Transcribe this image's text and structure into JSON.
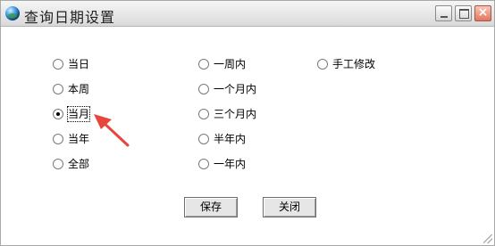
{
  "window": {
    "title": "查询日期设置"
  },
  "options": {
    "today": "当日",
    "this_week": "本周",
    "this_month": "当月",
    "this_year": "当年",
    "all": "全部",
    "one_week": "一周内",
    "one_month": "一个月内",
    "three_months": "三个月内",
    "half_year": "半年内",
    "one_year": "一年内",
    "manual": "手工修改",
    "selected": "当月"
  },
  "buttons": {
    "save": "保存",
    "close": "关闭"
  },
  "colors": {
    "annotation_arrow": "#e8453c"
  }
}
